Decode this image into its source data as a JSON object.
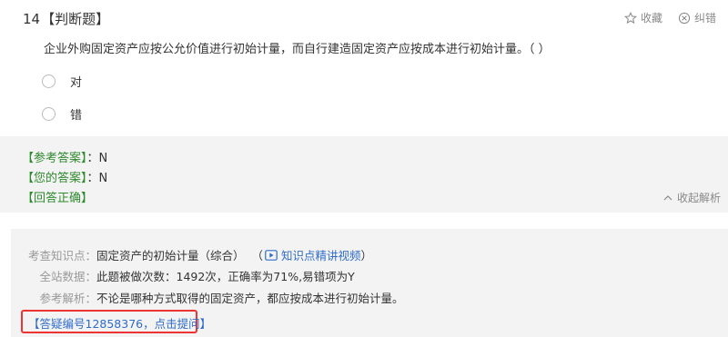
{
  "question": {
    "number": "14",
    "type": "【判断题】",
    "stem": "企业外购固定资产应按公允价值进行初始计量，而自行建造固定资产应按成本进行初始计量。（  ）",
    "options": [
      {
        "label": "对"
      },
      {
        "label": "错"
      }
    ]
  },
  "toolbar": {
    "favorite_label": "收藏",
    "report_label": "纠错"
  },
  "answer": {
    "reference_key": "【参考答案】",
    "reference_value": "：N",
    "yours_key": "【您的答案】",
    "yours_value": "：N",
    "result": "【回答正确】",
    "collapse_label": "收起解析"
  },
  "analysis": {
    "knowledge_key": "考查知识点：",
    "knowledge_value": "固定资产的初始计量（综合）",
    "paren_open": "（",
    "video_label": "知识点精讲视频",
    "paren_close": "）",
    "stats_key": "全站数据：",
    "stats_value": "此题被做次数：1492次，正确率为71%,易错项为Y",
    "ref_key": "参考解析：",
    "ref_value": "不论是哪种方式取得的固定资产，都应按成本进行初始计量。",
    "ask_link": "【答疑编号12858376，点击提问】"
  },
  "colors": {
    "green": "#2f8a2f",
    "link_blue": "#2f6cc8",
    "highlight_red": "#e33"
  }
}
